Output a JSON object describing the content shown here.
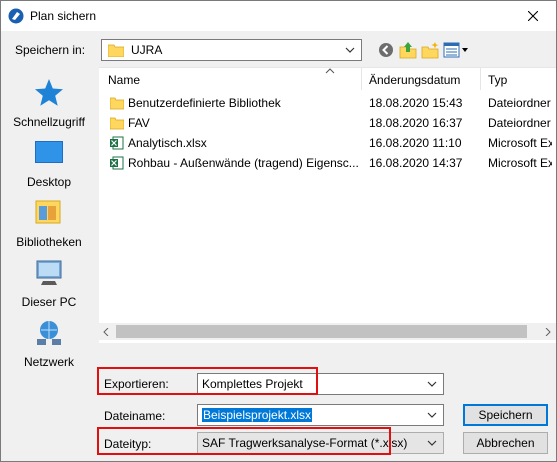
{
  "window": {
    "title": "Plan sichern"
  },
  "location": {
    "label": "Speichern in:",
    "value": "UJRA"
  },
  "places": [
    {
      "label": "Schnellzugriff",
      "icon": "star-icon"
    },
    {
      "label": "Desktop",
      "icon": "desktop-icon"
    },
    {
      "label": "Bibliotheken",
      "icon": "libraries-icon"
    },
    {
      "label": "Dieser PC",
      "icon": "computer-icon"
    },
    {
      "label": "Netzwerk",
      "icon": "network-icon"
    }
  ],
  "columns": {
    "name": "Name",
    "date": "Änderungsdatum",
    "type": "Typ"
  },
  "files": [
    {
      "name": "Benutzerdefinierte Bibliothek",
      "date": "18.08.2020 15:43",
      "type": "Dateiordner",
      "kind": "folder"
    },
    {
      "name": "FAV",
      "date": "18.08.2020 16:37",
      "type": "Dateiordner",
      "kind": "folder"
    },
    {
      "name": "Analytisch.xlsx",
      "date": "16.08.2020 11:10",
      "type": "Microsoft Ex",
      "kind": "excel"
    },
    {
      "name": "Rohbau - Außenwände (tragend) Eigensc...",
      "date": "16.08.2020 14:37",
      "type": "Microsoft Ex",
      "kind": "excel"
    }
  ],
  "export": {
    "label": "Exportieren:",
    "value": "Komplettes Projekt"
  },
  "filename": {
    "label": "Dateiname:",
    "value": "Beispielsprojekt.xlsx"
  },
  "filetype": {
    "label": "Dateityp:",
    "value": "SAF Tragwerksanalyse-Format (*.xlsx)"
  },
  "buttons": {
    "save": "Speichern",
    "cancel": "Abbrechen"
  },
  "colors": {
    "highlight": "#e01010",
    "accent": "#0078d7",
    "folder": "#ffd75e"
  }
}
